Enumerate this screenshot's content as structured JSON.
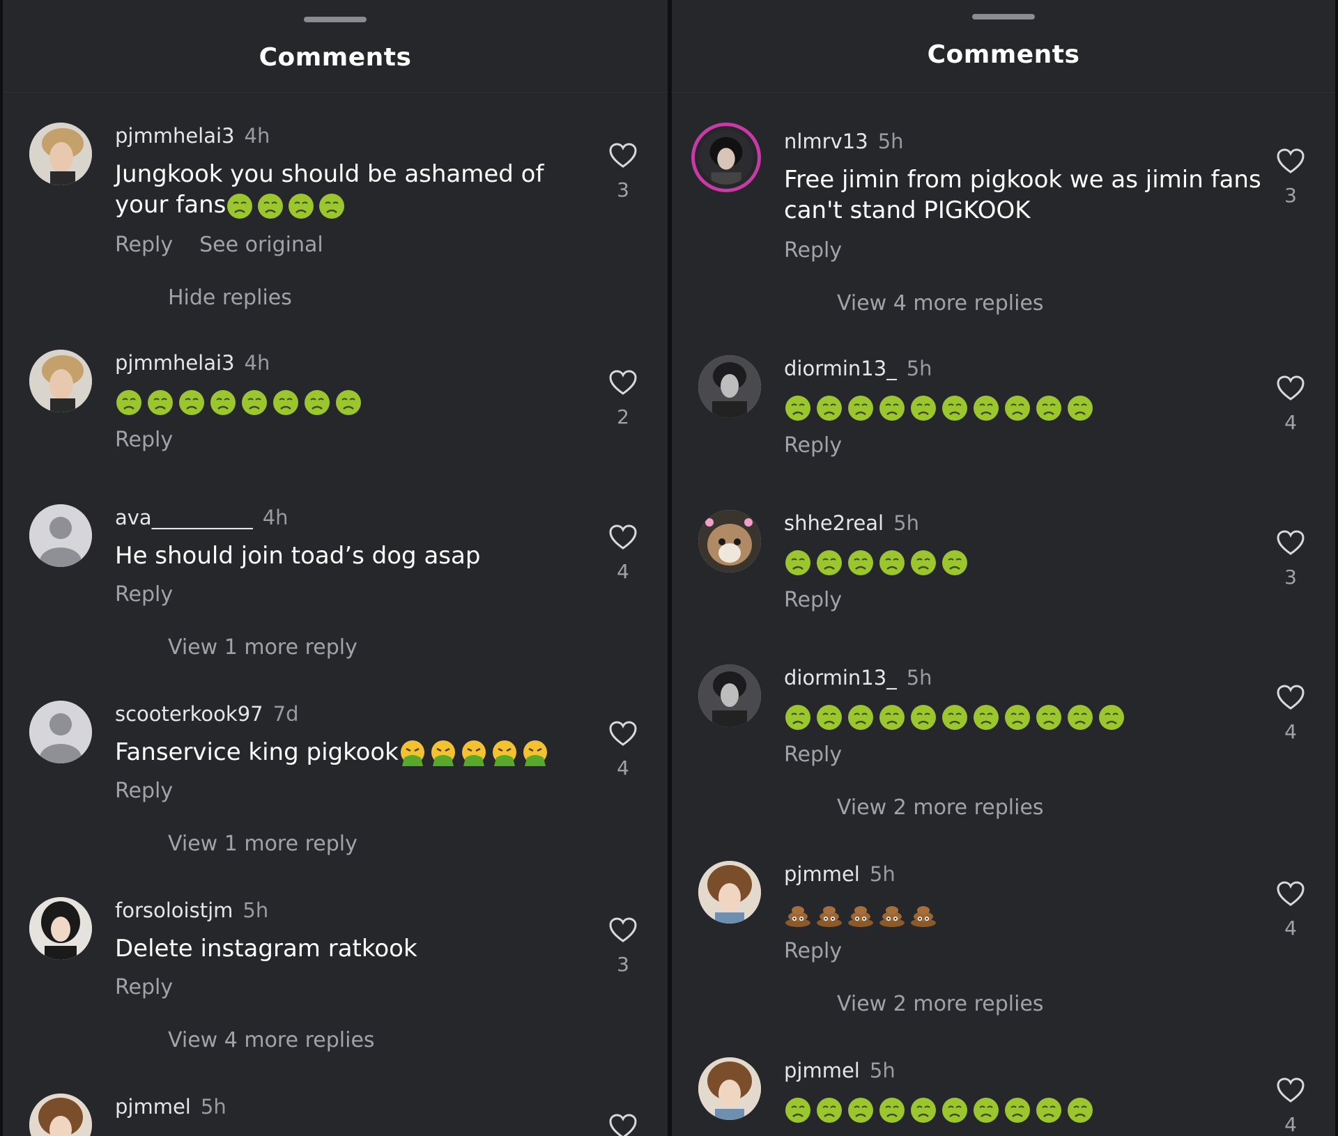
{
  "left": {
    "title": "Comments",
    "comments": [
      {
        "user": "pjmmhelai3",
        "time": "4h",
        "text": "Jungkook you should be ashamed of your fans",
        "likes": "3",
        "reply": "Reply",
        "see_original": "See original",
        "replies_link": "Hide replies"
      },
      {
        "user": "pjmmhelai3",
        "time": "4h",
        "likes": "2",
        "reply": "Reply"
      },
      {
        "user": "ava__________",
        "time": "4h",
        "text": "He should join toad’s dog asap",
        "likes": "4",
        "reply": "Reply",
        "replies_link": "View 1 more reply"
      },
      {
        "user": "scooterkook97",
        "time": "7d",
        "text": "Fanservice king pigkook",
        "likes": "4",
        "reply": "Reply",
        "replies_link": "View 1 more reply"
      },
      {
        "user": "forsoloistjm",
        "time": "5h",
        "text": "Delete instagram ratkook",
        "likes": "3",
        "reply": "Reply",
        "replies_link": "View 4 more replies"
      },
      {
        "user": "pjmmel",
        "time": "5h"
      }
    ]
  },
  "right": {
    "title": "Comments",
    "comments": [
      {
        "user": "nlmrv13",
        "time": "5h",
        "text": "Free jimin from pigkook we as jimin fans can't stand PIGKOOK",
        "likes": "3",
        "reply": "Reply",
        "replies_link": "View 4 more replies"
      },
      {
        "user": "diormin13_",
        "time": "5h",
        "likes": "4",
        "reply": "Reply"
      },
      {
        "user": "shhe2real",
        "time": "5h",
        "likes": "3",
        "reply": "Reply"
      },
      {
        "user": "diormin13_",
        "time": "5h",
        "likes": "4",
        "reply": "Reply",
        "replies_link": "View 2 more replies"
      },
      {
        "user": "pjmmel",
        "time": "5h",
        "likes": "4",
        "reply": "Reply",
        "replies_link": "View 2 more replies"
      },
      {
        "user": "pjmmel",
        "time": "5h",
        "likes": "4"
      }
    ]
  },
  "icons": {
    "like": "heart-outline-icon",
    "sick": "nauseated-face-emoji",
    "vomit": "vomiting-face-emoji",
    "poop": "pile-of-poo-emoji",
    "default_avatar": "person-silhouette-icon"
  },
  "colors": {
    "background": "#26272b",
    "text": "#ffffff",
    "muted": "#a2a3a8",
    "emoji_green": "#9bc62e"
  }
}
